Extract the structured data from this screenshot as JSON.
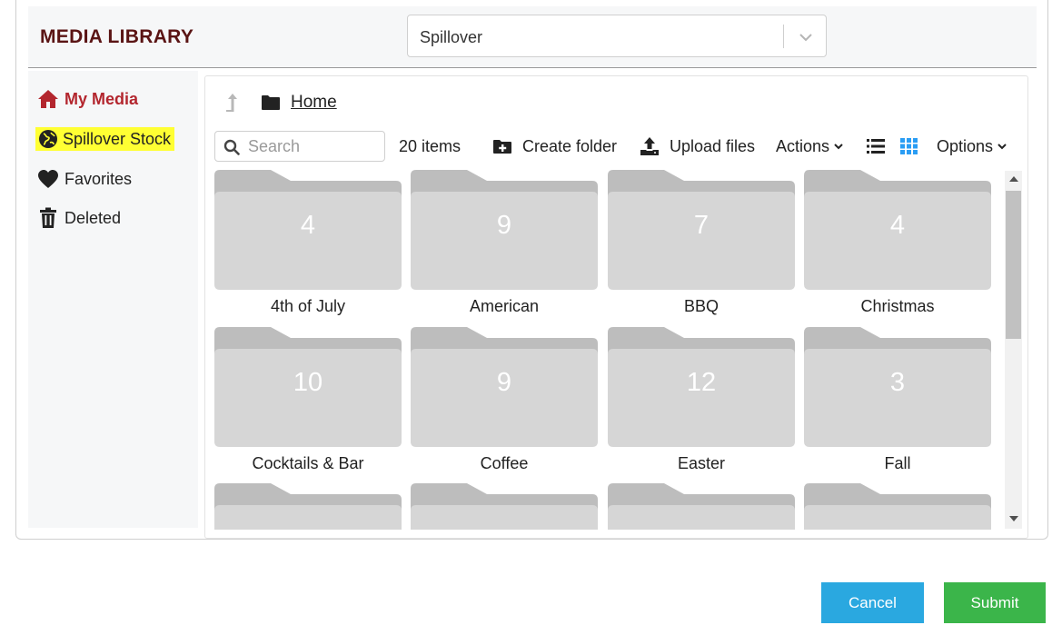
{
  "header": {
    "title": "MEDIA LIBRARY",
    "library_select": {
      "value": "Spillover"
    }
  },
  "sidebar": {
    "items": [
      {
        "label": "My Media",
        "icon": "home-icon",
        "active": true
      },
      {
        "label": "Spillover Stock",
        "icon": "globe-icon",
        "highlighted": true
      },
      {
        "label": "Favorites",
        "icon": "heart-icon"
      },
      {
        "label": "Deleted",
        "icon": "trash-icon"
      }
    ]
  },
  "breadcrumb": {
    "home_label": "Home"
  },
  "toolbar": {
    "search_placeholder": "Search",
    "item_count": "20 items",
    "create_folder": "Create folder",
    "upload_files": "Upload files",
    "actions": "Actions",
    "options": "Options"
  },
  "folders": [
    {
      "count": "4",
      "name": "4th of July"
    },
    {
      "count": "9",
      "name": "American"
    },
    {
      "count": "7",
      "name": "BBQ"
    },
    {
      "count": "4",
      "name": "Christmas"
    },
    {
      "count": "10",
      "name": "Cocktails & Bar"
    },
    {
      "count": "9",
      "name": "Coffee"
    },
    {
      "count": "12",
      "name": "Easter"
    },
    {
      "count": "3",
      "name": "Fall"
    },
    {
      "count": "",
      "name": ""
    },
    {
      "count": "",
      "name": ""
    },
    {
      "count": "",
      "name": ""
    },
    {
      "count": "",
      "name": ""
    }
  ],
  "footer": {
    "cancel_label": "Cancel",
    "submit_label": "Submit"
  },
  "colors": {
    "title": "#5a1414",
    "active_nav": "#b3262e",
    "highlight": "#ffff33",
    "folder_tab": "#bdbdbd",
    "folder_body": "#d6d6d6",
    "grid_view_active": "#2a9df4",
    "cancel": "#2aa8e0",
    "submit": "#3bb54a"
  }
}
